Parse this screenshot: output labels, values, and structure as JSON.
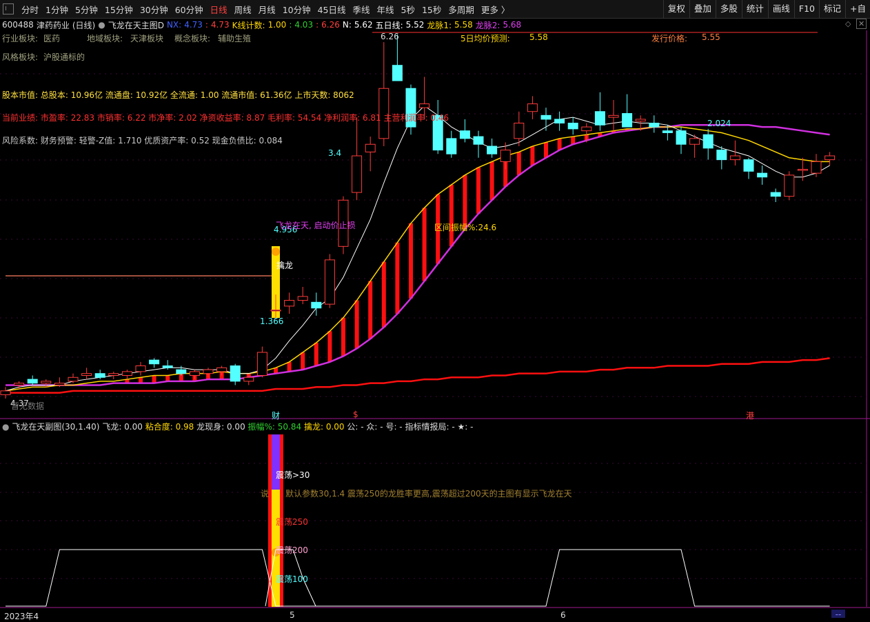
{
  "toolbar": {
    "items": [
      "分时",
      "1分钟",
      "5分钟",
      "15分钟",
      "30分钟",
      "60分钟",
      "日线",
      "周线",
      "月线",
      "10分钟",
      "45日线",
      "季线",
      "年线",
      "5秒",
      "15秒",
      "多周期",
      "更多 〉"
    ],
    "active_index": 6,
    "right_items": [
      "复权",
      "叠加",
      "多股",
      "统计",
      "画线",
      "F10",
      "标记",
      "+自"
    ]
  },
  "header": {
    "stock_code": "600488",
    "stock_name": "津药药业",
    "period": "(日线)",
    "indicator": "飞龙在天主图D",
    "nx_label": "NX:",
    "nx_value": "4.73",
    "nx_value2": "4.73",
    "k_count_label": "K线计数:",
    "k_count_value": "1.00",
    "k_value2": "4.03",
    "k_value3": "6.26",
    "n_label": "N:",
    "n_value": "5.62",
    "ma5_label": "五日线:",
    "ma5_value": "5.52",
    "lm1_label": "龙脉1:",
    "lm1_value": "5.58",
    "lm2_label": "龙脉2:",
    "lm2_value": "5.68"
  },
  "text_blocks": {
    "industry": "行业板块:",
    "industry_value": "医药",
    "region": "地域板块:",
    "region_value": "天津板块",
    "concept": "概念板块:",
    "concept_value": "辅助生殖",
    "style": "风格板块:",
    "style_value": "沪股通标的",
    "pred_label": "5日均价预测:",
    "pred_value": "5.58",
    "issue_label": "发行价格:",
    "issue_value": "5.55",
    "capital": "股本市值: 总股本: 10.96亿 流通盘: 10.92亿 全流通: 1.00 流通市值: 61.36亿 上市天数: 8062",
    "perf": "当前业绩: 市盈率: 22.83 市销率: 6.22 市净率: 2.02 净资收益率: 8.87 毛利率: 54.54 净利润率: 6.81 主营利润率: 0.46",
    "risk": "风险系数: 财务预警: 轻警-Z值: 1.710 优质资产率: 0.52 现金负债比: 0.084"
  },
  "annotations": {
    "high": "6.26",
    "price_2024": "2.024",
    "price_34": "3.4",
    "price_4956": "4.956",
    "price_1366": "1.366",
    "low": "4.37",
    "stop": "飞龙在天, 启动价止损",
    "range": "区间振幅%:24.6",
    "dragon": "擒龙",
    "no_data": "暂无数据",
    "cai": "财",
    "gang": "港",
    "dollar": "$"
  },
  "sub_header": {
    "name": "飞龙在天副图(30,1.40)",
    "feilong": "飞龙: 0.00",
    "nianhe": "粘合度: 0.98",
    "longxian": "龙现身: 0.00",
    "zhenfu": "振幅%: 50.84",
    "qinlong": "擒龙: 0.00",
    "gong": "公: -",
    "zhong": "众: -",
    "hao": "号: -",
    "zhibiao": "指标情报局: -",
    "star": "★: -"
  },
  "sub_labels": {
    "zd30": "震荡>30",
    "desc_prefix": "说",
    "desc": "默认参数30,1.4 震荡250的龙胜率更高,震荡超过200天的主图有显示飞龙在天",
    "zd250": "震荡250",
    "zd200": "震荡200",
    "zd100": "震荡100"
  },
  "xaxis": [
    "2023年4",
    "5",
    "6"
  ],
  "colors": {
    "up": "#ff3b3b",
    "down": "#54ffff",
    "ma5": "#ffffff",
    "lm1": "#ffd700",
    "lm2": "#d030e0",
    "slow": "#ff1010",
    "sub_line": "#ffffff"
  },
  "chart_data": {
    "type": "candlestick",
    "price_range": [
      4.37,
      6.26
    ],
    "candles": [
      {
        "o": 4.39,
        "h": 4.43,
        "l": 4.37,
        "c": 4.41
      },
      {
        "o": 4.44,
        "h": 4.46,
        "l": 4.42,
        "c": 4.45
      },
      {
        "o": 4.47,
        "h": 4.49,
        "l": 4.44,
        "c": 4.45
      },
      {
        "o": 4.45,
        "h": 4.47,
        "l": 4.43,
        "c": 4.46
      },
      {
        "o": 4.44,
        "h": 4.48,
        "l": 4.43,
        "c": 4.45
      },
      {
        "o": 4.46,
        "h": 4.5,
        "l": 4.45,
        "c": 4.48
      },
      {
        "o": 4.49,
        "h": 4.53,
        "l": 4.47,
        "c": 4.5
      },
      {
        "o": 4.5,
        "h": 4.52,
        "l": 4.47,
        "c": 4.48
      },
      {
        "o": 4.49,
        "h": 4.51,
        "l": 4.47,
        "c": 4.5
      },
      {
        "o": 4.49,
        "h": 4.52,
        "l": 4.47,
        "c": 4.51
      },
      {
        "o": 4.51,
        "h": 4.56,
        "l": 4.49,
        "c": 4.54
      },
      {
        "o": 4.57,
        "h": 4.58,
        "l": 4.53,
        "c": 4.55
      },
      {
        "o": 4.54,
        "h": 4.57,
        "l": 4.52,
        "c": 4.53
      },
      {
        "o": 4.52,
        "h": 4.54,
        "l": 4.49,
        "c": 4.5
      },
      {
        "o": 4.49,
        "h": 4.52,
        "l": 4.47,
        "c": 4.51
      },
      {
        "o": 4.5,
        "h": 4.53,
        "l": 4.48,
        "c": 4.52
      },
      {
        "o": 4.51,
        "h": 4.54,
        "l": 4.49,
        "c": 4.53
      },
      {
        "o": 4.54,
        "h": 4.55,
        "l": 4.44,
        "c": 4.46
      },
      {
        "o": 4.46,
        "h": 4.49,
        "l": 4.44,
        "c": 4.48
      },
      {
        "o": 4.49,
        "h": 4.64,
        "l": 4.48,
        "c": 4.61
      },
      {
        "o": 4.83,
        "h": 4.91,
        "l": 4.78,
        "c": 4.83
      },
      {
        "o": 4.85,
        "h": 4.92,
        "l": 4.81,
        "c": 4.88
      },
      {
        "o": 4.88,
        "h": 4.95,
        "l": 4.86,
        "c": 4.9
      },
      {
        "o": 4.87,
        "h": 4.92,
        "l": 4.8,
        "c": 4.84
      },
      {
        "o": 4.86,
        "h": 5.12,
        "l": 4.84,
        "c": 5.09
      },
      {
        "o": 5.16,
        "h": 5.42,
        "l": 5.12,
        "c": 5.4
      },
      {
        "o": 5.44,
        "h": 5.83,
        "l": 5.4,
        "c": 5.63
      },
      {
        "o": 5.65,
        "h": 5.73,
        "l": 5.55,
        "c": 5.69
      },
      {
        "o": 5.72,
        "h": 6.22,
        "l": 5.68,
        "c": 5.98
      },
      {
        "o": 6.1,
        "h": 6.26,
        "l": 6.02,
        "c": 6.02
      },
      {
        "o": 5.98,
        "h": 6.0,
        "l": 5.74,
        "c": 5.78
      },
      {
        "o": 5.88,
        "h": 6.04,
        "l": 5.82,
        "c": 5.9
      },
      {
        "o": 5.84,
        "h": 5.92,
        "l": 5.64,
        "c": 5.66
      },
      {
        "o": 5.72,
        "h": 5.76,
        "l": 5.62,
        "c": 5.64
      },
      {
        "o": 5.76,
        "h": 5.82,
        "l": 5.7,
        "c": 5.72
      },
      {
        "o": 5.73,
        "h": 5.76,
        "l": 5.62,
        "c": 5.69
      },
      {
        "o": 5.68,
        "h": 5.72,
        "l": 5.62,
        "c": 5.64
      },
      {
        "o": 5.6,
        "h": 5.7,
        "l": 5.56,
        "c": 5.66
      },
      {
        "o": 5.72,
        "h": 5.86,
        "l": 5.68,
        "c": 5.8
      },
      {
        "o": 5.86,
        "h": 5.94,
        "l": 5.82,
        "c": 5.9
      },
      {
        "o": 5.84,
        "h": 5.88,
        "l": 5.76,
        "c": 5.82
      },
      {
        "o": 5.82,
        "h": 5.86,
        "l": 5.76,
        "c": 5.8
      },
      {
        "o": 5.8,
        "h": 5.83,
        "l": 5.74,
        "c": 5.77
      },
      {
        "o": 5.76,
        "h": 5.8,
        "l": 5.7,
        "c": 5.78
      },
      {
        "o": 5.86,
        "h": 5.96,
        "l": 5.76,
        "c": 5.79
      },
      {
        "o": 5.83,
        "h": 5.92,
        "l": 5.76,
        "c": 5.84
      },
      {
        "o": 5.85,
        "h": 5.95,
        "l": 5.78,
        "c": 5.78
      },
      {
        "o": 5.81,
        "h": 5.84,
        "l": 5.76,
        "c": 5.82
      },
      {
        "o": 5.8,
        "h": 5.84,
        "l": 5.75,
        "c": 5.78
      },
      {
        "o": 5.76,
        "h": 5.79,
        "l": 5.71,
        "c": 5.75
      },
      {
        "o": 5.76,
        "h": 5.78,
        "l": 5.64,
        "c": 5.69
      },
      {
        "o": 5.69,
        "h": 5.74,
        "l": 5.62,
        "c": 5.72
      },
      {
        "o": 5.74,
        "h": 5.77,
        "l": 5.61,
        "c": 5.67
      },
      {
        "o": 5.66,
        "h": 5.68,
        "l": 5.56,
        "c": 5.61
      },
      {
        "o": 5.61,
        "h": 5.71,
        "l": 5.58,
        "c": 5.63
      },
      {
        "o": 5.61,
        "h": 5.62,
        "l": 5.51,
        "c": 5.55
      },
      {
        "o": 5.54,
        "h": 5.58,
        "l": 5.48,
        "c": 5.52
      },
      {
        "o": 5.44,
        "h": 5.46,
        "l": 5.39,
        "c": 5.42
      },
      {
        "o": 5.42,
        "h": 5.55,
        "l": 5.4,
        "c": 5.53
      },
      {
        "o": 5.56,
        "h": 5.62,
        "l": 5.5,
        "c": 5.56
      },
      {
        "o": 5.54,
        "h": 5.64,
        "l": 5.52,
        "c": 5.6
      },
      {
        "o": 5.61,
        "h": 5.65,
        "l": 5.58,
        "c": 5.63
      }
    ],
    "ma5": [
      4.41,
      4.43,
      4.44,
      4.44,
      4.44,
      4.46,
      4.47,
      4.48,
      4.49,
      4.5,
      4.51,
      4.52,
      4.53,
      4.53,
      4.52,
      4.52,
      4.52,
      4.5,
      4.5,
      4.52,
      4.58,
      4.67,
      4.75,
      4.84,
      4.89,
      5.0,
      5.15,
      5.3,
      5.49,
      5.67,
      5.82,
      5.89,
      5.84,
      5.78,
      5.74,
      5.7,
      5.67,
      5.68,
      5.7,
      5.74,
      5.78,
      5.82,
      5.83,
      5.81,
      5.79,
      5.8,
      5.81,
      5.8,
      5.8,
      5.79,
      5.76,
      5.73,
      5.7,
      5.67,
      5.65,
      5.63,
      5.59,
      5.55,
      5.52,
      5.52,
      5.54,
      5.58
    ],
    "lm1": [
      4.41,
      4.42,
      4.43,
      4.43,
      4.44,
      4.44,
      4.45,
      4.46,
      4.46,
      4.47,
      4.48,
      4.49,
      4.49,
      4.5,
      4.5,
      4.5,
      4.51,
      4.5,
      4.5,
      4.51,
      4.53,
      4.56,
      4.61,
      4.66,
      4.72,
      4.79,
      4.88,
      4.98,
      5.08,
      5.18,
      5.28,
      5.36,
      5.43,
      5.48,
      5.53,
      5.57,
      5.6,
      5.63,
      5.65,
      5.68,
      5.7,
      5.72,
      5.73,
      5.74,
      5.75,
      5.76,
      5.77,
      5.77,
      5.78,
      5.78,
      5.78,
      5.77,
      5.76,
      5.75,
      5.73,
      5.71,
      5.68,
      5.65,
      5.62,
      5.61,
      5.6,
      5.6
    ],
    "lm2": [
      4.44,
      4.44,
      4.44,
      4.44,
      4.44,
      4.44,
      4.44,
      4.44,
      4.45,
      4.45,
      4.45,
      4.45,
      4.46,
      4.46,
      4.46,
      4.47,
      4.47,
      4.47,
      4.48,
      4.49,
      4.5,
      4.51,
      4.52,
      4.54,
      4.56,
      4.59,
      4.63,
      4.68,
      4.74,
      4.81,
      4.89,
      4.98,
      5.07,
      5.16,
      5.25,
      5.33,
      5.4,
      5.47,
      5.53,
      5.58,
      5.62,
      5.66,
      5.69,
      5.71,
      5.73,
      5.75,
      5.76,
      5.77,
      5.78,
      5.78,
      5.79,
      5.79,
      5.79,
      5.79,
      5.79,
      5.79,
      5.78,
      5.78,
      5.77,
      5.76,
      5.75,
      5.74
    ],
    "slow": [
      4.4,
      4.4,
      4.4,
      4.4,
      4.4,
      4.41,
      4.41,
      4.41,
      4.41,
      4.41,
      4.41,
      4.41,
      4.41,
      4.41,
      4.41,
      4.41,
      4.41,
      4.41,
      4.41,
      4.41,
      4.42,
      4.42,
      4.42,
      4.43,
      4.43,
      4.44,
      4.44,
      4.45,
      4.45,
      4.46,
      4.46,
      4.47,
      4.47,
      4.48,
      4.48,
      4.48,
      4.49,
      4.49,
      4.5,
      4.5,
      4.5,
      4.51,
      4.51,
      4.51,
      4.52,
      4.52,
      4.53,
      4.53,
      4.53,
      4.54,
      4.54,
      4.54,
      4.54,
      4.55,
      4.55,
      4.55,
      4.56,
      4.56,
      4.56,
      4.57,
      4.57,
      4.58
    ],
    "sub_line": [
      0,
      0,
      0,
      0,
      1,
      1,
      1,
      1,
      1,
      1,
      1,
      1,
      1,
      1,
      1,
      1,
      1,
      1,
      1,
      1,
      0,
      0,
      0,
      0,
      0,
      0,
      0,
      0,
      0,
      0,
      0,
      0,
      0,
      0,
      0,
      0,
      0,
      0,
      0,
      0,
      0,
      1,
      1,
      1,
      1,
      1,
      1,
      1,
      1,
      1,
      1,
      0,
      0,
      0,
      0,
      0,
      0,
      0,
      0,
      0,
      0,
      0
    ]
  }
}
